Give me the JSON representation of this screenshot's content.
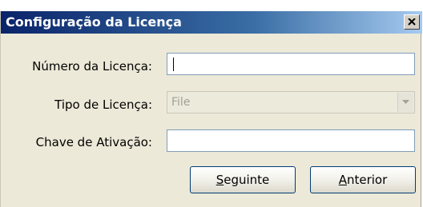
{
  "window": {
    "title": "Configuração da Licença",
    "close_icon": "close-icon"
  },
  "form": {
    "license_number": {
      "label": "Número da Licença:",
      "value": ""
    },
    "license_type": {
      "label": "Tipo de Licença:",
      "selected": "File",
      "disabled": true
    },
    "activation_key": {
      "label": "Chave de Ativação:",
      "value": ""
    }
  },
  "buttons": {
    "next": {
      "mnemonic": "S",
      "rest": "eguinte"
    },
    "previous": {
      "mnemonic": "A",
      "rest": "nterior"
    }
  },
  "colors": {
    "title_bar_start": "#0a246a",
    "title_bar_end": "#a6caf0",
    "dialog_background": "#ece9d8",
    "field_border": "#7f9db9"
  }
}
